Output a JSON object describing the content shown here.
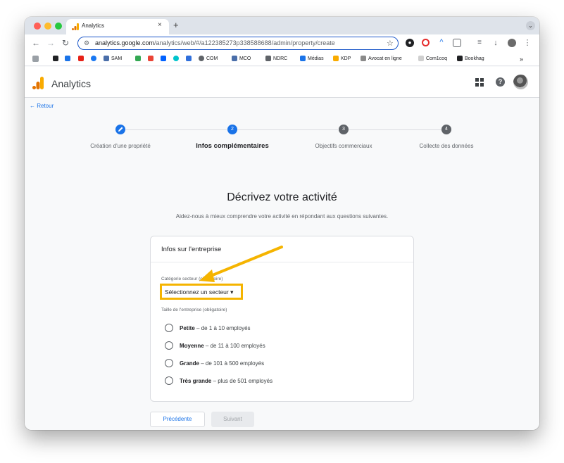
{
  "browser": {
    "tab_title": "Analytics",
    "tab_close": "×",
    "new_tab": "+",
    "url_host": "analytics.google.com",
    "url_path": "/analytics/web/#/a122385273p338588688/admin/property/create",
    "bookmarks": [
      "SAM",
      "COM",
      "MCO",
      "NDRC",
      "Médias",
      "KDP",
      "Avocat en ligne",
      "Com1coq",
      "Bookhag"
    ],
    "bookmarks_more": "»"
  },
  "header": {
    "app_title": "Analytics",
    "help_label": "?"
  },
  "nav": {
    "back_label": "← Retour"
  },
  "stepper": {
    "steps": [
      {
        "label": "Création d'une propriété",
        "badge": "",
        "state": "done"
      },
      {
        "label": "Infos complémentaires",
        "badge": "2",
        "state": "active"
      },
      {
        "label": "Objectifs commerciaux",
        "badge": "3",
        "state": "pending"
      },
      {
        "label": "Collecte des données",
        "badge": "4",
        "state": "pending"
      }
    ]
  },
  "main": {
    "title": "Décrivez votre activité",
    "subtitle": "Aidez-nous à mieux comprendre votre activité en répondant aux questions suivantes."
  },
  "card": {
    "title": "Infos sur l'entreprise",
    "category_label": "Catégorie secteur (obligatoire)",
    "category_value": "Sélectionnez un secteur",
    "size_label": "Taille de l'entreprise (obligatoire)",
    "sizes": [
      {
        "name": "Petite",
        "desc": " – de 1 à 10 employés"
      },
      {
        "name": "Moyenne",
        "desc": " – de 11 à 100 employés"
      },
      {
        "name": "Grande",
        "desc": " – de 101 à 500 employés"
      },
      {
        "name": "Très grande",
        "desc": " – plus de 501 employés"
      }
    ]
  },
  "actions": {
    "prev_label": "Précédente",
    "next_label": "Suivant"
  },
  "colors": {
    "accent": "#1a73e8",
    "highlight": "#f5b400",
    "step_pending": "#5f6368"
  }
}
